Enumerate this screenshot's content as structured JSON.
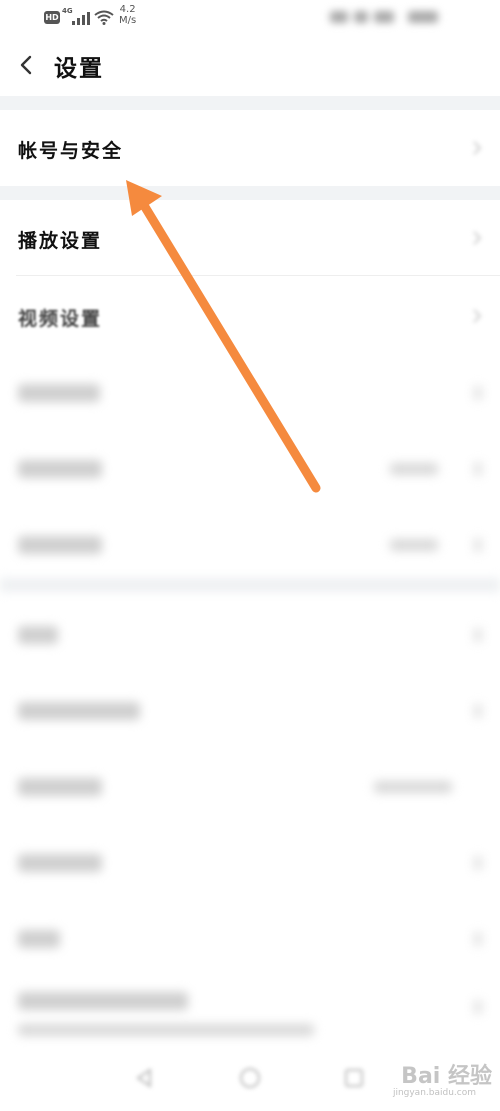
{
  "status_bar": {
    "hd_badge": "HD",
    "network": "4G",
    "speed_value": "4.2",
    "speed_unit": "M/s"
  },
  "header": {
    "title": "设置"
  },
  "settings": {
    "account_security": "帐号与安全",
    "playback_settings": "播放设置",
    "video_settings": "视频设置"
  },
  "watermark": {
    "brand": "Bai 经验",
    "url": "jingyan.baidu.com"
  },
  "colors": {
    "accent_arrow": "#F58A3E",
    "section_gap": "#F1F3F5"
  }
}
